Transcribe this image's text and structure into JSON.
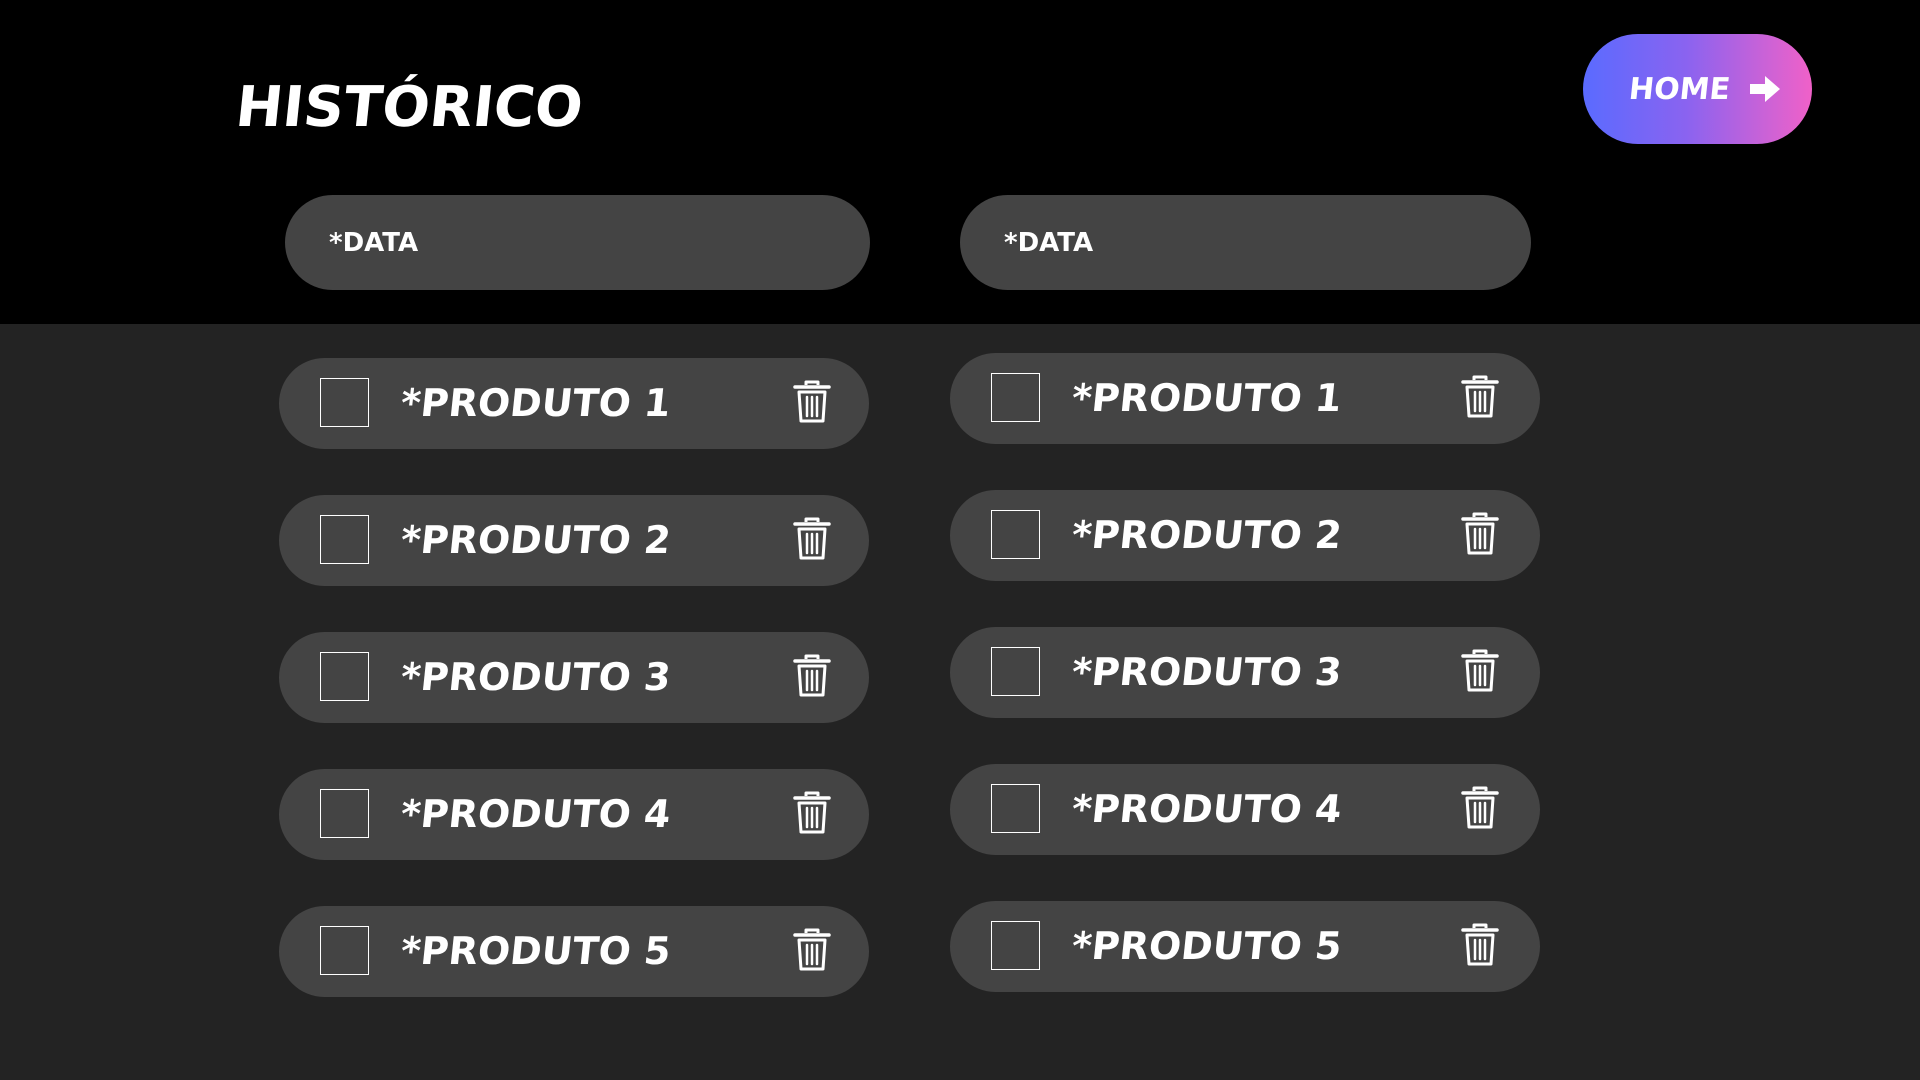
{
  "header": {
    "title": "HISTÓRICO",
    "home_label": "HOME",
    "home_icon": "arrow-right-icon"
  },
  "filters": {
    "left_date_placeholder": "*DATA",
    "right_date_placeholder": "*DATA"
  },
  "lists": {
    "left": [
      {
        "label": "*PRODUTO 1",
        "checked": false
      },
      {
        "label": "*PRODUTO 2",
        "checked": false
      },
      {
        "label": "*PRODUTO 3",
        "checked": false
      },
      {
        "label": "*PRODUTO 4",
        "checked": false
      },
      {
        "label": "*PRODUTO 5",
        "checked": false
      }
    ],
    "right": [
      {
        "label": "*PRODUTO 1",
        "checked": false
      },
      {
        "label": "*PRODUTO 2",
        "checked": false
      },
      {
        "label": "*PRODUTO 3",
        "checked": false
      },
      {
        "label": "*PRODUTO 4",
        "checked": false
      },
      {
        "label": "*PRODUTO 5",
        "checked": false
      }
    ]
  },
  "icons": {
    "delete": "trash-icon"
  },
  "colors": {
    "header_bg": "#000000",
    "body_bg": "#232323",
    "pill_bg": "#444444",
    "home_gradient_start": "#5a6bff",
    "home_gradient_end": "#f061c8",
    "text": "#ffffff"
  }
}
